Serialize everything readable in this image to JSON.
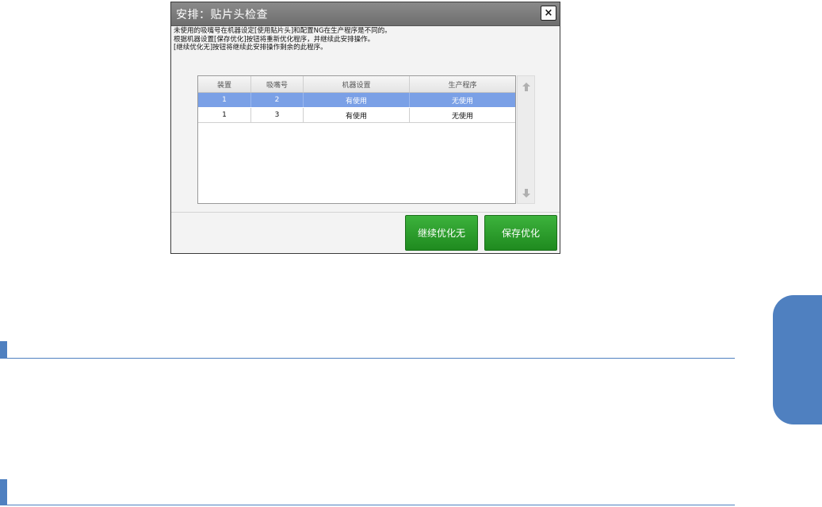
{
  "dialog": {
    "title": "安排：贴片头检查",
    "close_label": "×",
    "message_lines": [
      "未使用的吸嘴号在机器设定[使用贴片头]和配置NG在生产程序是不同的。",
      "根据机器设置[保存优化]按钮将重新优化程序，并继续此安排操作。",
      "[继续优化无]按钮将继续此安排操作剩余的此程序。"
    ],
    "table": {
      "headers": [
        "装置",
        "吸嘴号",
        "机器设置",
        "生产程序"
      ],
      "rows": [
        [
          "1",
          "2",
          "有使用",
          "无使用"
        ],
        [
          "1",
          "3",
          "有使用",
          "无使用"
        ]
      ],
      "selected_row": 0
    },
    "scroll_up_icon": "arrow-up-icon",
    "scroll_down_icon": "arrow-down-icon",
    "buttons": {
      "continue_label": "继续优化无",
      "save_label": "保存优化"
    }
  },
  "colors": {
    "accent_blue": "#4f80c0",
    "selected_row": "#7aa0e6",
    "button_green": "#2a9a2a",
    "titlebar": "#7a7a7a"
  }
}
